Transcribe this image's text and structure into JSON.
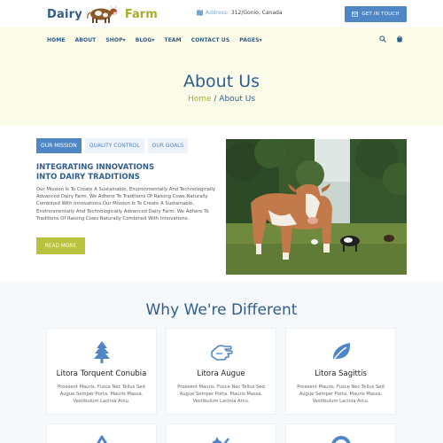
{
  "header": {
    "logo_left": "Dairy",
    "logo_right": "Farm",
    "address_label": "Address:",
    "address_value": "312/Gonio, Canada",
    "cta_label": "GET IN TOUCH"
  },
  "nav": {
    "items": [
      "HOME",
      "ABOUT",
      "SHOP",
      "BLOG",
      "TEAM",
      "CONTACT US",
      "PAGES"
    ],
    "dropdown_indicator": "▾"
  },
  "banner": {
    "title": "About Us",
    "crumb_home": "Home",
    "crumb_sep": " / ",
    "crumb_current": "About Us"
  },
  "about": {
    "tabs": [
      "OUR MISSION",
      "QUALITY CONTROL",
      "OUR GOALS"
    ],
    "active_tab": "OUR MISSION",
    "heading_line1": "INTEGRATING INNOVATIONS",
    "heading_line2": "INTO DAIRY TRADITIONS",
    "text": "Our Mission Is To Create A Sustainable, Environmentally And Technologically Advanced Dairy Farm. We Adhere To Traditions Of Raising Cows Naturally Combined With Innovations.Our Mission Is To Create A Sustainable, Environmentally And Technologically Advanced Dairy Farm. We Adhere To Traditions Of Raising Cows Naturally Combined With Innovations.",
    "button_label": "READ MORE"
  },
  "why": {
    "title": "Why We're Different",
    "cards": [
      {
        "title": "Litora Torquent Conubia",
        "text": "Proesent Mauris. Fusce Nec Tellus Sed Augue Semper Porta. Mauris Massa. Vestibulum Lacinia Arcu.",
        "icon": "tree-icon"
      },
      {
        "title": "Litora Augue",
        "text": "Proesent Mauris. Fusce Nec Tellus Sed Augue Semper Porta. Mauris Massa. Vestibulum Lacinia Arcu.",
        "icon": "hand-icon"
      },
      {
        "title": "Litora Sagittis",
        "text": "Proesent Mauris. Fusce Nec Tellus Sed Augue Semper Porta. Mauris Massa. Vestibulum Lacinia Arcu.",
        "icon": "leaf-icon"
      }
    ]
  },
  "colors": {
    "primary": "#2f5d8c",
    "accent_blue": "#4f86c6",
    "accent_green": "#a6ad2f",
    "banner_bg": "#fbfbe9"
  }
}
